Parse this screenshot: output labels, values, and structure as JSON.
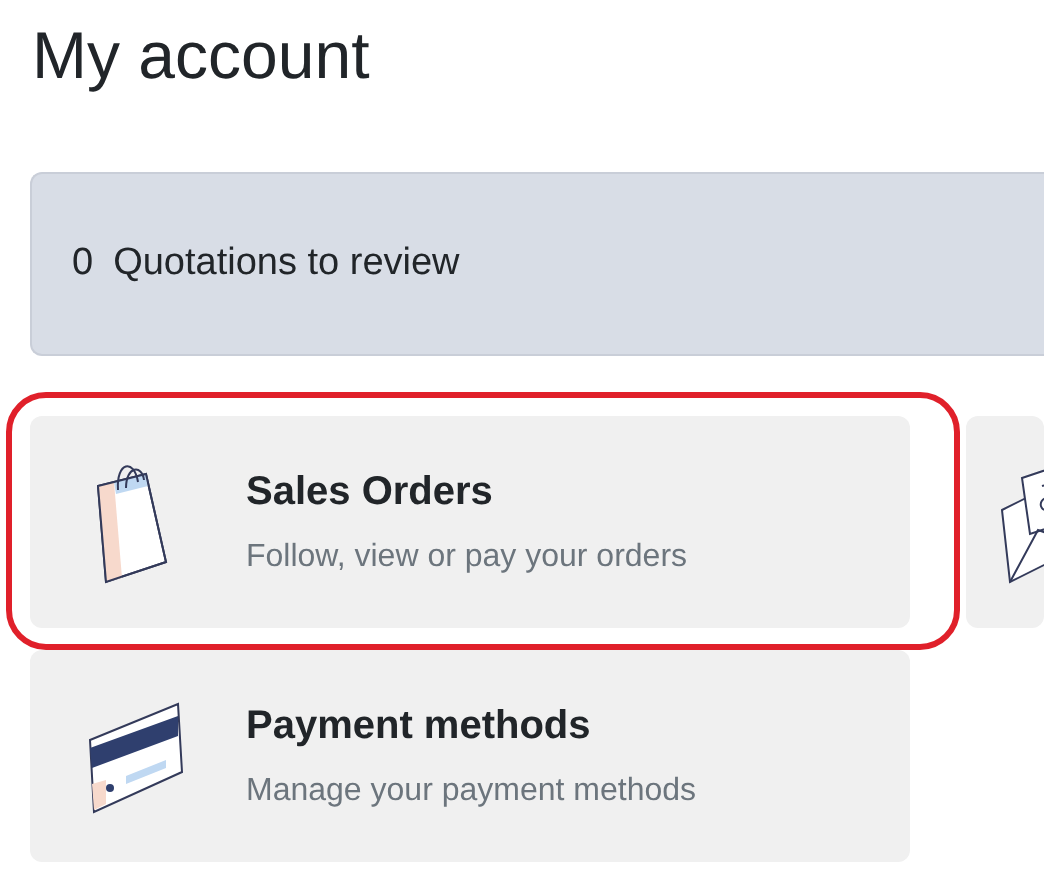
{
  "page": {
    "title": "My account"
  },
  "alert": {
    "count": "0",
    "label": "Quotations to review"
  },
  "cards": [
    {
      "kind": "bag",
      "title": "Sales Orders",
      "description": "Follow, view or pay your orders",
      "highlighted": true
    },
    {
      "kind": "envelope",
      "highlighted": false
    },
    {
      "kind": "credit-card",
      "title": "Payment methods",
      "description": "Manage your payment methods",
      "highlighted": false
    }
  ]
}
